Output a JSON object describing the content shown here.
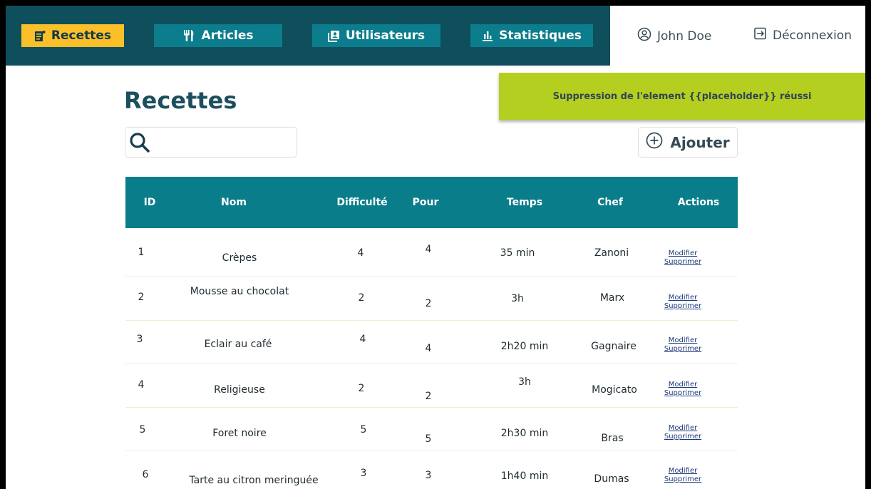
{
  "nav": {
    "items": [
      {
        "label": "Recettes",
        "icon": "recipe-icon",
        "active": true
      },
      {
        "label": "Articles",
        "icon": "fork-knife-icon",
        "active": false
      },
      {
        "label": "Utilisateurs",
        "icon": "users-icon",
        "active": false
      },
      {
        "label": "Statistiques",
        "icon": "bar-chart-icon",
        "active": false
      }
    ],
    "user_name": "John Doe",
    "logout_label": "Déconnexion"
  },
  "toast": {
    "message": "Suppression de l'element {{placeholder}} réussi"
  },
  "page": {
    "title": "Recettes",
    "search_value": "",
    "add_label": "Ajouter"
  },
  "table": {
    "headers": {
      "id": "ID",
      "name": "Nom",
      "difficulty": "Difficulté",
      "servings": "Pour",
      "time": "Temps",
      "chef": "Chef",
      "actions": "Actions"
    },
    "edit_label": "Modifier",
    "delete_label": "Supprimer",
    "rows": [
      {
        "id": "1",
        "name": "Crèpes",
        "difficulty": "4",
        "servings": "4",
        "time": "35 min",
        "chef": "Zanoni"
      },
      {
        "id": "2",
        "name": "Mousse au chocolat",
        "difficulty": "2",
        "servings": "2",
        "time": "3h",
        "chef": "Marx"
      },
      {
        "id": "3",
        "name": "Eclair au café",
        "difficulty": "4",
        "servings": "4",
        "time": "2h20 min",
        "chef": "Gagnaire"
      },
      {
        "id": "4",
        "name": "Religieuse",
        "difficulty": "2",
        "servings": "2",
        "time": "3h",
        "chef": "Mogicato"
      },
      {
        "id": "5",
        "name": "Foret noire",
        "difficulty": "5",
        "servings": "5",
        "time": "2h30 min",
        "chef": "Bras"
      },
      {
        "id": "6",
        "name": "Tarte au citron meringuée",
        "difficulty": "3",
        "servings": "3",
        "time": "1h40 min",
        "chef": "Dumas"
      }
    ]
  },
  "colors": {
    "topbar": "#0e4f5b",
    "nav_button": "#0c7d8c",
    "nav_active": "#fbbf2a",
    "table_header": "#0a7d8b",
    "toast": "#b5cf20",
    "title": "#1c4e5e"
  }
}
